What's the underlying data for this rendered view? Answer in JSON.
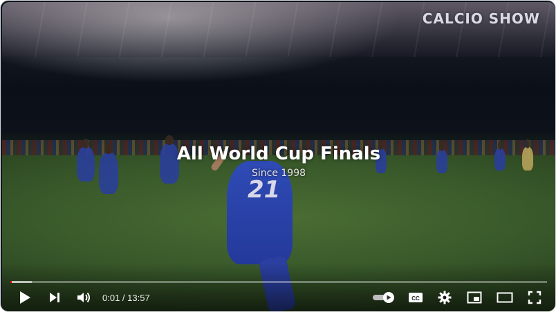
{
  "player": {
    "overlay": {
      "logo_text": "CALCIO SHOW",
      "title": "All World Cup Finals",
      "subtitle": "Since 1998",
      "jersey_number": "21"
    },
    "controls": {
      "time_display": "0:01 / 13:57",
      "progress_fraction": 0.0012,
      "loaded_fraction": 0.04,
      "autoplay_on": true,
      "buttons": [
        {
          "id": "play",
          "icon": "play-icon"
        },
        {
          "id": "next",
          "icon": "next-icon"
        },
        {
          "id": "volume",
          "icon": "volume-icon"
        },
        {
          "id": "autoplay",
          "icon": "autoplay-toggle-icon"
        },
        {
          "id": "captions",
          "icon": "cc-icon",
          "text": "CC"
        },
        {
          "id": "settings",
          "icon": "gear-icon"
        },
        {
          "id": "miniplayer",
          "icon": "miniplayer-icon"
        },
        {
          "id": "theater",
          "icon": "theater-mode-icon"
        },
        {
          "id": "fullscreen",
          "icon": "fullscreen-icon"
        }
      ]
    },
    "colors": {
      "progress_played": "#ff0000",
      "control_icon": "#ffffff"
    }
  }
}
